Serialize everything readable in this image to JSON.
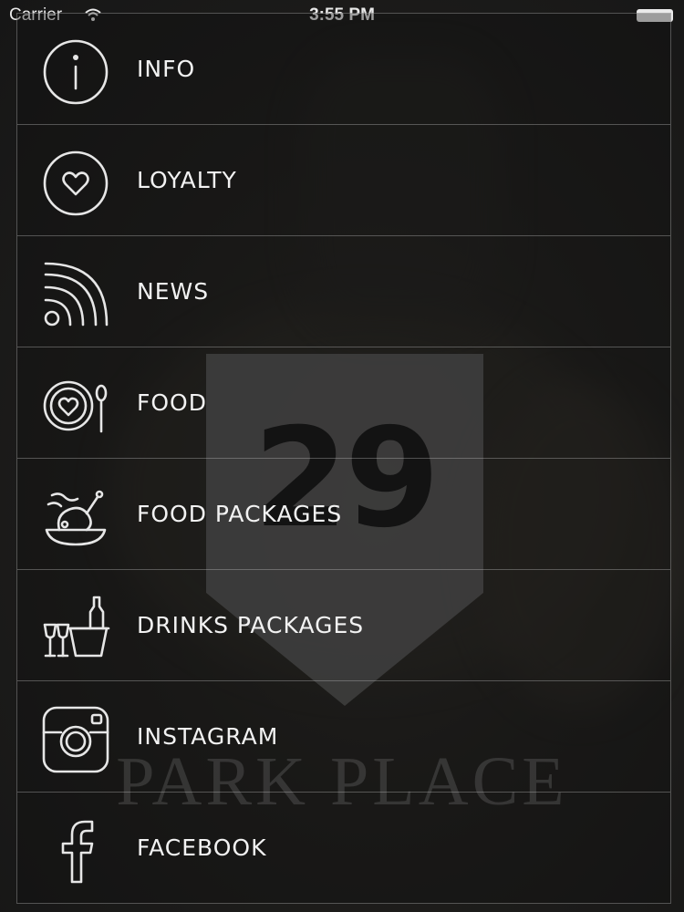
{
  "status_bar": {
    "carrier": "Carrier",
    "time": "3:55 PM"
  },
  "logo": {
    "number": "29",
    "name": "PARK PLACE"
  },
  "menu": {
    "items": [
      {
        "label": "INFO",
        "icon": "info-icon"
      },
      {
        "label": "LOYALTY",
        "icon": "heart-icon"
      },
      {
        "label": "NEWS",
        "icon": "rss-icon"
      },
      {
        "label": "FOOD",
        "icon": "plate-heart-icon"
      },
      {
        "label": "FOOD PACKAGES",
        "icon": "roast-chicken-icon"
      },
      {
        "label": "DRINKS PACKAGES",
        "icon": "champagne-bucket-icon"
      },
      {
        "label": "INSTAGRAM",
        "icon": "instagram-icon"
      },
      {
        "label": "FACEBOOK",
        "icon": "facebook-icon"
      }
    ]
  },
  "colors": {
    "text": "#f2f2f2",
    "icon_stroke": "#e6e6e6",
    "divider": "#5a5a5a",
    "logo_shield": "#5e5e5e"
  }
}
